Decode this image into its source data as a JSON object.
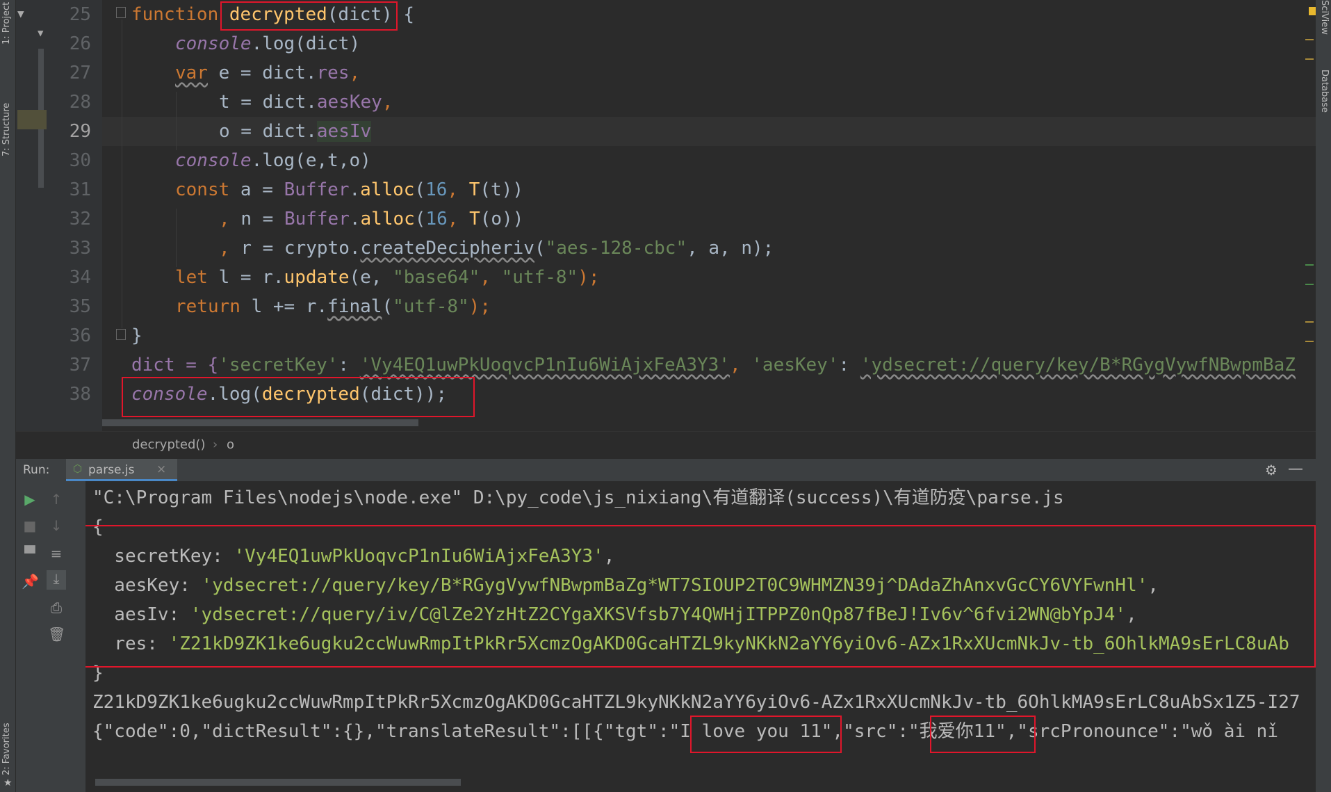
{
  "left_strip": {
    "project_tab": "1: Project",
    "structure_tab": "7: Structure",
    "favorites_tab": "2: Favorites"
  },
  "right_strip": {
    "sciview_tab": "SciView",
    "database_tab": "Database"
  },
  "editor": {
    "line_numbers": [
      "25",
      "26",
      "27",
      "28",
      "29",
      "30",
      "31",
      "32",
      "33",
      "34",
      "35",
      "36",
      "37",
      "38"
    ],
    "current_line": "29",
    "lines": {
      "l25": {
        "kw": "function",
        "fn": "decrypted",
        "rest": "(dict) {"
      },
      "l26": {
        "obj": "console",
        "rest": ".log(dict)"
      },
      "l27": {
        "kw": "var",
        "mid": " e = dict.",
        "prop": "res",
        "end": ","
      },
      "l28": {
        "mid": "t = dict.",
        "prop": "aesKey",
        "end": ","
      },
      "l29": {
        "mid": "o = dict.",
        "prop": "aesIv"
      },
      "l30": {
        "obj": "console",
        "rest": ".log(e,t,o)"
      },
      "l31": {
        "kw": "const",
        "mid": " a = ",
        "cls": "Buffer",
        "dot": ".",
        "fn": "alloc",
        "open": "(",
        "num": "16",
        "comma": ", ",
        "fn2": "T",
        "args": "(t))"
      },
      "l32": {
        "comma0": ", ",
        "mid": "n = ",
        "cls": "Buffer",
        "dot": ".",
        "fn": "alloc",
        "open": "(",
        "num": "16",
        "comma": ", ",
        "fn2": "T",
        "args": "(o))"
      },
      "l33": {
        "comma0": ", ",
        "mid": "r = crypto.",
        "fn": "createDecipheriv",
        "open": "(",
        "str": "\"aes-128-cbc\"",
        "rest": ", a, n);"
      },
      "l34": {
        "kw": "let",
        "mid": " l = r.",
        "fn": "update",
        "open": "(e, ",
        "str1": "\"base64\"",
        "sep": ", ",
        "str2": "\"utf-8\"",
        "end": ");"
      },
      "l35": {
        "kw": "return",
        "mid": " l += r.",
        "fn": "final",
        "open": "(",
        "str": "\"utf-8\"",
        "end": ");"
      },
      "l36": {
        "text": "}"
      },
      "l37": {
        "pre": "dict = {",
        "k1": "'secretKey'",
        "c1": ": ",
        "v1": "'Vy4EQ1uwPkUoqvcP1nIu6WiAjxFeA3Y3'",
        "s1": ", ",
        "k2": "'aesKey'",
        "c2": ": ",
        "v2": "'ydsecret://query/key/B*RGygVywfNBwpmBaZ"
      },
      "l38": {
        "obj": "console",
        "mid": ".log(",
        "fn": "decrypted",
        "rest": "(dict));"
      }
    }
  },
  "breadcrumb": {
    "func": "decrypted()",
    "sep": "›",
    "var": "o"
  },
  "run": {
    "label": "Run:",
    "tab": "parse.js",
    "close": "×"
  },
  "console": {
    "cmd": "\"C:\\Program Files\\nodejs\\node.exe\" D:\\py_code\\js_nixiang\\有道翻译(success)\\有道防疫\\parse.js",
    "open_brace": "{",
    "secretKey_label": "  secretKey: ",
    "secretKey_val": "'Vy4EQ1uwPkUoqvcP1nIu6WiAjxFeA3Y3'",
    "secretKey_end": ",",
    "aesKey_label": "  aesKey: ",
    "aesKey_val": "'ydsecret://query/key/B*RGygVywfNBwpmBaZg*WT7SIOUP2T0C9WHMZN39j^DAdaZhAnxvGcCY6VYFwnHl'",
    "aesKey_end": ",",
    "aesIv_label": "  aesIv: ",
    "aesIv_val": "'ydsecret://query/iv/C@lZe2YzHtZ2CYgaXKSVfsb7Y4QWHjITPPZ0nQp87fBeJ!Iv6v^6fvi2WN@bYpJ4'",
    "aesIv_end": ",",
    "res_label": "  res: ",
    "res_val": "'Z21kD9ZK1ke6ugku2ccWuwRmpItPkRr5XcmzOgAKD0GcaHTZL9kyNKkN2aYY6yiOv6-AZx1RxXUcmNkJv-tb_6OhlkMA9sErLC8uAb",
    "close_brace": "}",
    "res_echo": "Z21kD9ZK1ke6ugku2ccWuwRmpItPkRr5XcmzOgAKD0GcaHTZL9kyNKkN2aYY6yiOv6-AZx1RxXUcmNkJv-tb_6OhlkMA9sErLC8uAbSx1Z5-I27",
    "result_pre": "{\"code\":0,\"dictResult\":{},\"translateResult\":[[{\"tgt\":\"",
    "tgt": "I love you 11",
    "result_mid": "\",\"src\":\"",
    "src": "我爱你11",
    "result_post": "\",\"srcPronounce\":\"wǒ ài nǐ"
  }
}
